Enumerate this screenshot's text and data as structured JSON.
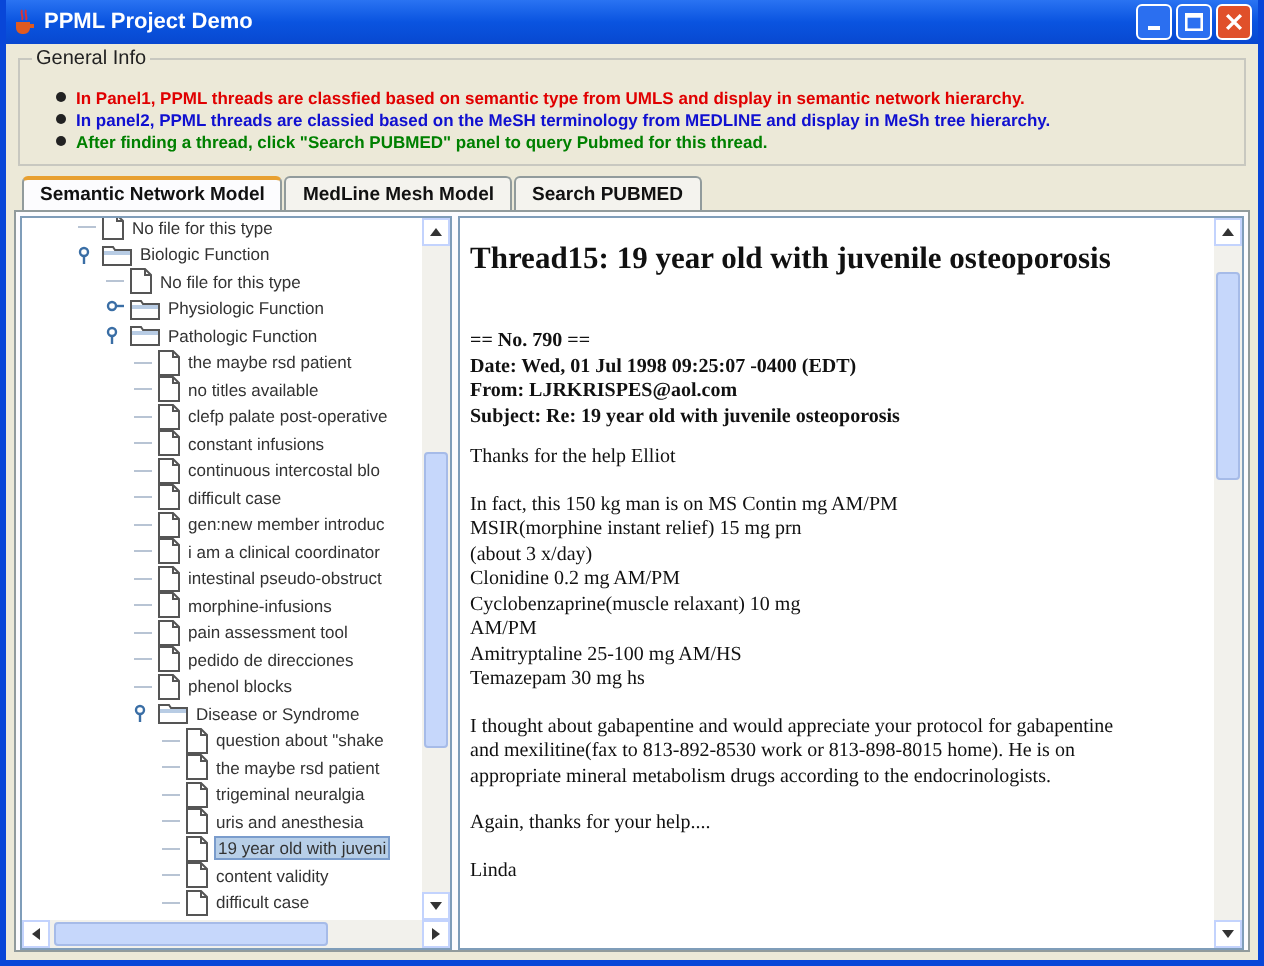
{
  "window": {
    "title": "PPML Project Demo"
  },
  "general_info": {
    "legend": "General Info",
    "notes": [
      {
        "text": "In Panel1, PPML threads are classfied based on semantic type from UMLS and display in semantic network hierarchy.",
        "color": "#e00000"
      },
      {
        "text": "In panel2, PPML threads are classied based on the MeSH terminology from MEDLINE and display in MeSh tree hierarchy.",
        "color": "#1010d0"
      },
      {
        "text": "After finding a thread, click \"Search PUBMED\" panel to query Pubmed for this thread.",
        "color": "#008000"
      }
    ]
  },
  "tabs": [
    {
      "label": "Semantic Network Model",
      "selected": true
    },
    {
      "label": "MedLine Mesh Model",
      "selected": false
    },
    {
      "label": "Search PUBMED",
      "selected": false
    }
  ],
  "tree": [
    {
      "kind": "file",
      "label": "No file for this type",
      "selected": false
    },
    {
      "kind": "folder",
      "label": "Biologic Function",
      "expanded": true,
      "children": [
        {
          "kind": "file",
          "label": "No file for this type",
          "selected": false
        },
        {
          "kind": "folder",
          "label": "Physiologic Function",
          "expanded": false
        },
        {
          "kind": "folder",
          "label": "Pathologic Function",
          "expanded": true,
          "children": [
            {
              "kind": "file",
              "label": "the maybe rsd patient",
              "selected": false
            },
            {
              "kind": "file",
              "label": "no titles available",
              "selected": false
            },
            {
              "kind": "file",
              "label": "clefp palate post-operative",
              "selected": false
            },
            {
              "kind": "file",
              "label": "constant infusions",
              "selected": false
            },
            {
              "kind": "file",
              "label": "continuous intercostal blo",
              "selected": false
            },
            {
              "kind": "file",
              "label": "difficult case",
              "selected": false
            },
            {
              "kind": "file",
              "label": "gen:new member introduc",
              "selected": false
            },
            {
              "kind": "file",
              "label": "i am a clinical coordinator",
              "selected": false
            },
            {
              "kind": "file",
              "label": "intestinal pseudo-obstruct",
              "selected": false
            },
            {
              "kind": "file",
              "label": "morphine-infusions",
              "selected": false
            },
            {
              "kind": "file",
              "label": "pain assessment tool",
              "selected": false
            },
            {
              "kind": "file",
              "label": "pedido de direcciones",
              "selected": false
            },
            {
              "kind": "file",
              "label": "phenol blocks",
              "selected": false
            },
            {
              "kind": "folder",
              "label": "Disease or Syndrome",
              "expanded": true,
              "children": [
                {
                  "kind": "file",
                  "label": "question about \"shake",
                  "selected": false
                },
                {
                  "kind": "file",
                  "label": "the maybe rsd patient",
                  "selected": false
                },
                {
                  "kind": "file",
                  "label": "trigeminal neuralgia",
                  "selected": false
                },
                {
                  "kind": "file",
                  "label": "uris and anesthesia",
                  "selected": false
                },
                {
                  "kind": "file",
                  "label": "19 year old with juveni",
                  "selected": true
                },
                {
                  "kind": "file",
                  "label": "content validity",
                  "selected": false
                },
                {
                  "kind": "file",
                  "label": "difficult case",
                  "selected": false
                }
              ]
            }
          ]
        }
      ]
    }
  ],
  "document": {
    "title": "Thread15: 19 year old with juvenile osteoporosis",
    "header": [
      "== No. 790 ==",
      "Date: Wed, 01 Jul 1998 09:25:07 -0400 (EDT)",
      "From: LJRKRISPES@aol.com",
      "Subject: Re: 19 year old with juvenile osteoporosis"
    ],
    "paragraphs": [
      [
        "Thanks for the help Elliot"
      ],
      [
        "In fact, this 150 kg man is on MS Contin mg AM/PM",
        "MSIR(morphine instant relief) 15 mg prn",
        "(about 3 x/day)",
        "Clonidine 0.2 mg AM/PM",
        "Cyclobenzaprine(muscle relaxant) 10 mg",
        "AM/PM",
        "Amitryptaline 25-100 mg AM/HS",
        "Temazepam 30 mg hs"
      ],
      [
        "I thought about gabapentine and would appreciate your protocol for gabapentine",
        "and mexilitine(fax to 813-892-8530 work or 813-898-8015 home). He is on",
        "appropriate mineral metabolism drugs according to the endocrinologists."
      ],
      [
        "Again, thanks for your help...."
      ],
      [
        "Linda"
      ]
    ]
  }
}
